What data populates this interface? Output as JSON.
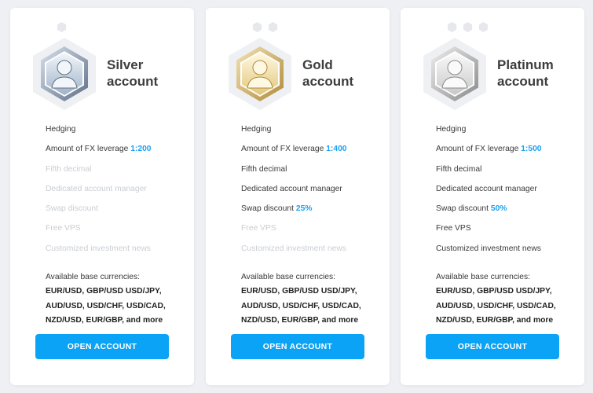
{
  "accounts": [
    {
      "title_line1": "Silver",
      "title_line2": "account",
      "tier_icon": "silver-user-badge-icon",
      "dot_count": 1,
      "colors": {
        "frame_light": "#d8e2ec",
        "frame_dark": "#5e6f86",
        "inner": "#9fb2c8",
        "figure": "#f2f6fa"
      },
      "features": [
        {
          "text": "Hedging",
          "value": "",
          "enabled": true
        },
        {
          "text": "Amount of FX leverage ",
          "value": "1:200",
          "enabled": true
        },
        {
          "text": "Fifth decimal",
          "value": "",
          "enabled": false
        },
        {
          "text": "Dedicated account manager",
          "value": "",
          "enabled": false
        },
        {
          "text": "Swap discount",
          "value": "",
          "enabled": false
        },
        {
          "text": "Free VPS",
          "value": "",
          "enabled": false
        },
        {
          "text": "Customized investment news",
          "value": "",
          "enabled": false
        }
      ],
      "currencies_label": "Available base currencies:",
      "currencies_lines": [
        "EUR/USD, GBP/USD USD/JPY,",
        "AUD/USD, USD/CHF, USD/CAD,",
        "NZD/USD, EUR/GBP, and more"
      ],
      "button_label": "OPEN ACCOUNT"
    },
    {
      "title_line1": "Gold",
      "title_line2": "account",
      "tier_icon": "gold-user-badge-icon",
      "dot_count": 2,
      "colors": {
        "frame_light": "#f3e3b4",
        "frame_dark": "#b08a3a",
        "inner": "#e2c77c",
        "figure": "#fff8e2"
      },
      "features": [
        {
          "text": "Hedging",
          "value": "",
          "enabled": true
        },
        {
          "text": "Amount of FX leverage ",
          "value": "1:400",
          "enabled": true
        },
        {
          "text": "Fifth decimal",
          "value": "",
          "enabled": true
        },
        {
          "text": "Dedicated account manager",
          "value": "",
          "enabled": true
        },
        {
          "text": "Swap discount ",
          "value": "25%",
          "enabled": true
        },
        {
          "text": "Free VPS",
          "value": "",
          "enabled": false
        },
        {
          "text": "Customized investment news",
          "value": "",
          "enabled": false
        }
      ],
      "currencies_label": "Available base currencies:",
      "currencies_lines": [
        "EUR/USD, GBP/USD USD/JPY,",
        "AUD/USD, USD/CHF, USD/CAD,",
        "NZD/USD, EUR/GBP, and more"
      ],
      "button_label": "OPEN ACCOUNT"
    },
    {
      "title_line1": "Platinum",
      "title_line2": "account",
      "tier_icon": "platinum-user-badge-icon",
      "dot_count": 3,
      "colors": {
        "frame_light": "#eeeeee",
        "frame_dark": "#8a8a8a",
        "inner": "#c8c8c8",
        "figure": "#fafafa"
      },
      "features": [
        {
          "text": "Hedging",
          "value": "",
          "enabled": true
        },
        {
          "text": "Amount of FX leverage ",
          "value": "1:500",
          "enabled": true
        },
        {
          "text": "Fifth decimal",
          "value": "",
          "enabled": true
        },
        {
          "text": "Dedicated account manager",
          "value": "",
          "enabled": true
        },
        {
          "text": "Swap discount ",
          "value": "50%",
          "enabled": true
        },
        {
          "text": "Free VPS",
          "value": "",
          "enabled": true
        },
        {
          "text": "Customized investment news",
          "value": "",
          "enabled": true
        }
      ],
      "currencies_label": "Available base currencies:",
      "currencies_lines": [
        "EUR/USD, GBP/USD USD/JPY,",
        "AUD/USD, USD/CHF, USD/CAD,",
        "NZD/USD, EUR/GBP, and more"
      ],
      "button_label": "OPEN ACCOUNT"
    }
  ],
  "theme": {
    "accent": "#0aa3f5",
    "highlight_value": "#1da1f2",
    "disabled_text": "#c9cdd2"
  }
}
